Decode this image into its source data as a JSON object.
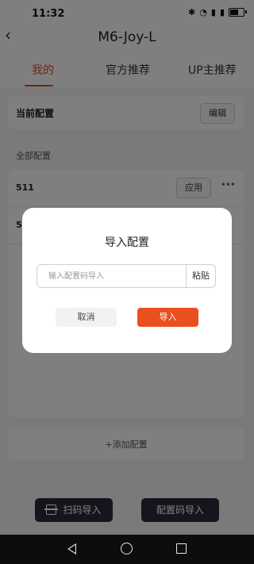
{
  "status_bar": {
    "time": "11:32",
    "icons": [
      "bluetooth-icon",
      "wifi-icon",
      "signal-icon",
      "signal-icon",
      "battery-icon"
    ]
  },
  "header": {
    "title": "M6-Joy-L",
    "back_icon": "chevron-left-icon"
  },
  "tabs": [
    {
      "label": "我的",
      "active": true
    },
    {
      "label": "官方推荐",
      "active": false
    },
    {
      "label": "UP主推荐",
      "active": false
    }
  ],
  "current_config": {
    "label": "当前配置",
    "edit_label": "编辑"
  },
  "all_configs": {
    "section_label": "全部配置",
    "items": [
      {
        "name": "511",
        "apply_label": "应用",
        "more": "•••"
      },
      {
        "name": "5",
        "apply_label": "",
        "more": ""
      }
    ]
  },
  "add_config": {
    "label": "+添加配置"
  },
  "bottom_buttons": {
    "scan_label": "扫码导入",
    "code_label": "配置码导入"
  },
  "dialog": {
    "title": "导入配置",
    "input_placeholder": "输入配置码导入",
    "input_value": "",
    "paste_label": "粘贴",
    "cancel_label": "取消",
    "import_label": "导入"
  },
  "colors": {
    "accent": "#e24b22",
    "import_button": "#ea4f1f",
    "bottom_button": "#2a2d3a"
  }
}
